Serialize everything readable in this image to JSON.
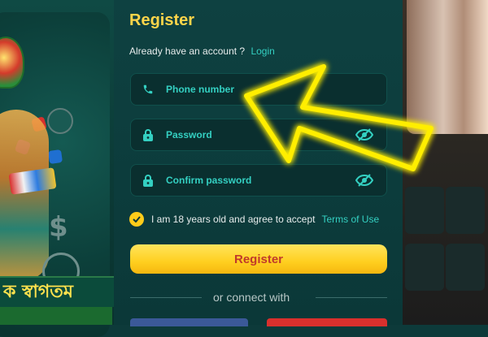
{
  "form": {
    "title": "Register",
    "account_prompt": "Already have an account ?",
    "login_link": "Login",
    "fields": [
      {
        "placeholder": "Phone number",
        "icon": "phone-icon"
      },
      {
        "placeholder": "Password",
        "icon": "lock-icon",
        "toggle_icon": "eye-slash-icon"
      },
      {
        "placeholder": "Confirm password",
        "icon": "lock-icon",
        "toggle_icon": "eye-slash-icon"
      }
    ],
    "agree_text": "I am 18 years old and agree to accept",
    "terms_link": "Terms of Use",
    "agree_checked": true,
    "register_button": "Register",
    "connect_text": "or connect with"
  },
  "banner": {
    "bengali_text": "ক স্বাগতম"
  },
  "colors": {
    "accent_teal": "#34d0c2",
    "title_yellow": "#ffd54a",
    "button_yellow": "#ffcf1f",
    "button_text": "#c0392b",
    "panel_bg": "#0b3838",
    "field_bg": "#0a2f2f",
    "arrow": "#ffee00"
  }
}
